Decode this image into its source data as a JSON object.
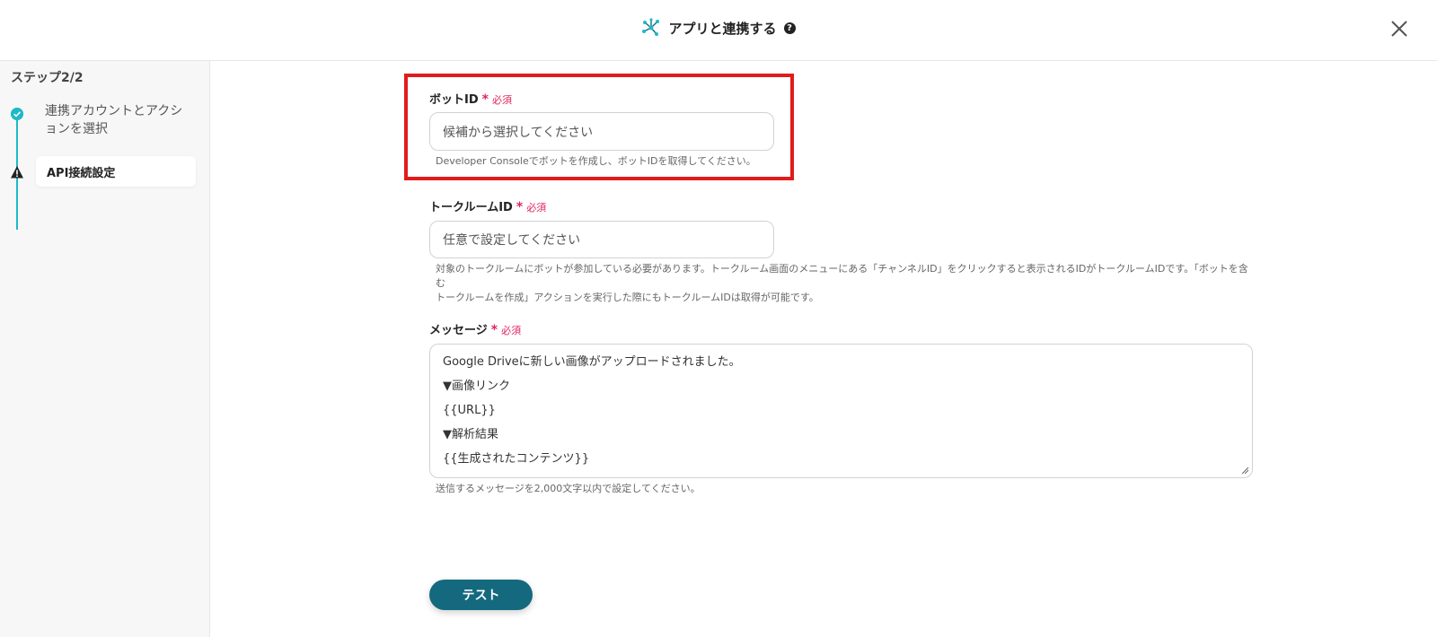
{
  "header": {
    "title": "アプリと連携する",
    "help_icon": "question-circle-icon",
    "close_icon": "close-icon"
  },
  "sidebar": {
    "step_title": "ステップ2/2",
    "steps": [
      {
        "label": "連携アカウントとアクションを選択",
        "status": "completed",
        "icon": "check-circle-icon"
      },
      {
        "label": "API接続設定",
        "status": "current",
        "icon": "warning-icon"
      }
    ]
  },
  "form": {
    "required_text": "必須",
    "bot_id": {
      "label": "ボットID",
      "placeholder": "候補から選択してください",
      "hint": "Developer Consoleでボットを作成し、ボットIDを取得してください。"
    },
    "talk_room_id": {
      "label": "トークルームID",
      "placeholder": "任意で設定してください",
      "hint_line1": "対象のトークルームにボットが参加している必要があります。トークルーム画面のメニューにある「チャンネルID」をクリックすると表示されるIDがトークルームIDです。「ボットを含む",
      "hint_line2": "トークルームを作成」アクションを実行した際にもトークルームIDは取得が可能です。"
    },
    "message": {
      "label": "メッセージ",
      "lines": [
        "Google Driveに新しい画像がアップロードされました。",
        "▼画像リンク",
        "{{URL}}",
        "▼解析結果",
        "{{生成されたコンテンツ}}"
      ],
      "hint": "送信するメッセージを2,000文字以内で設定してください。"
    },
    "test_button": "テスト"
  },
  "colors": {
    "accent": "#1eb9c8",
    "button": "#14697f",
    "required": "#e0245e",
    "highlight": "#e01c1c"
  }
}
